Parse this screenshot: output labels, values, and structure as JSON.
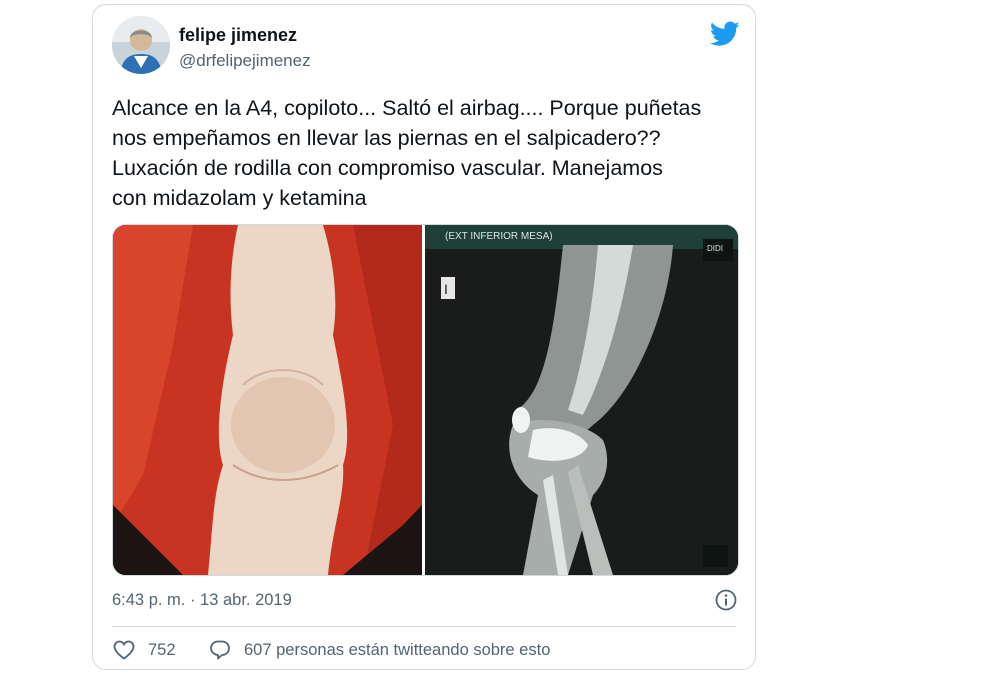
{
  "user": {
    "display_name": "felipe jimenez",
    "handle": "@drfelipejimenez"
  },
  "tweet": {
    "text": "Alcance en la A4, copiloto... Saltó el airbag.... Porque puñetas\nnos empeñamos en llevar las piernas en el salpicadero??\nLuxación de rodilla con compromiso vascular. Manejamos\ncon midazolam y ketamina",
    "timestamp": "6:43 p. m. · 13 abr. 2019"
  },
  "engagement": {
    "likes": "752",
    "conversation": "607 personas están twitteando sobre esto"
  },
  "xray_overlay": {
    "top_label": "(EXT INFERIOR MESA)",
    "side_marker": "I",
    "corner_label": "DIDI"
  },
  "icons": {
    "brand": "twitter-bird-icon",
    "info": "info-icon",
    "like": "heart-icon",
    "reply": "speech-bubble-icon"
  },
  "colors": {
    "twitter_blue": "#1d9bf0",
    "secondary_text": "#536471",
    "border": "#cfd9de"
  }
}
